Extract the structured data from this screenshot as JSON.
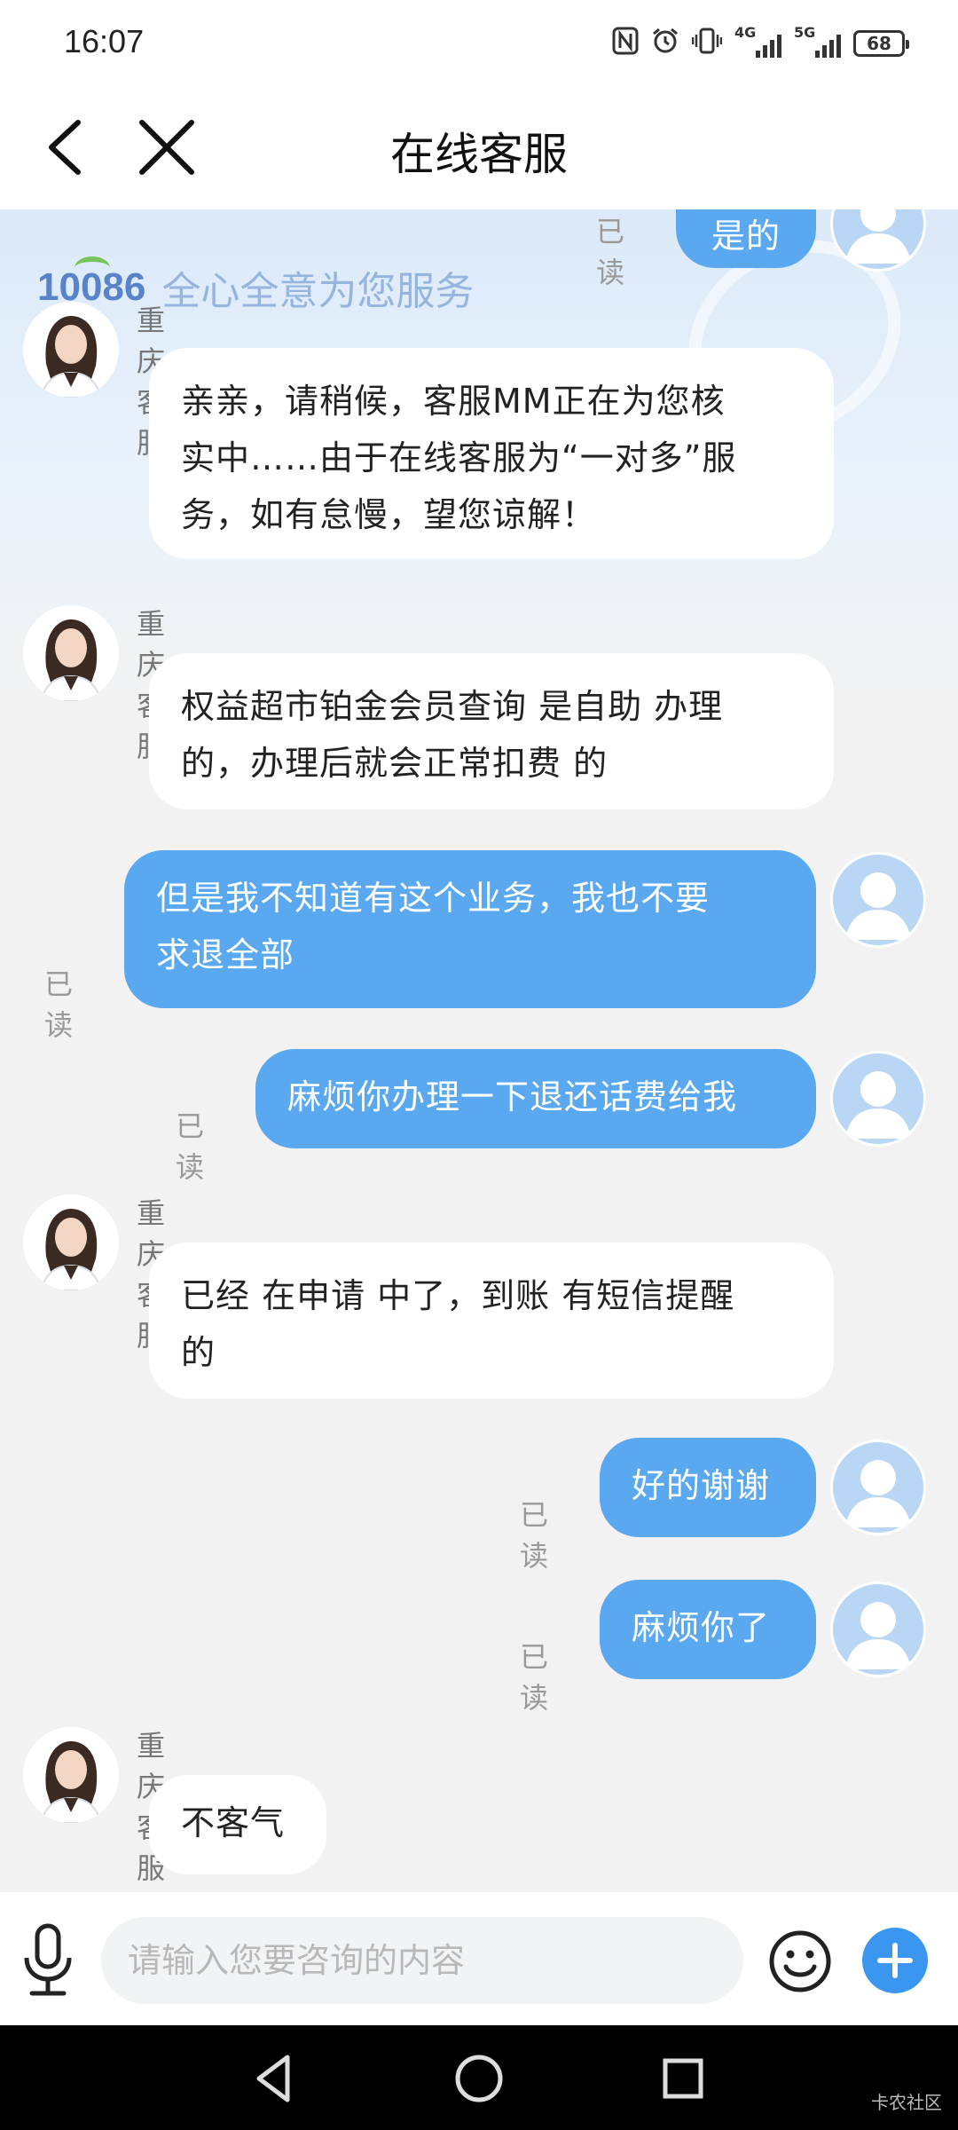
{
  "status_bar": {
    "time": "16:07",
    "icons": [
      "nfc-icon",
      "alarm-icon",
      "vibrate-icon",
      "signal-4g-icon",
      "signal-5g-icon",
      "battery-icon"
    ],
    "signal_1_label": "4G",
    "signal_2_label": "5G",
    "battery": "68"
  },
  "header": {
    "title": "在线客服"
  },
  "banner": {
    "logo": "10086",
    "slogan": "全心全意为您服务"
  },
  "messages": [
    {
      "from": "user",
      "text": "是的",
      "read": "已读"
    },
    {
      "from": "agent",
      "sender": "重庆客服",
      "lines": [
        "亲亲，请稍候，客服MM正在为您核",
        "实中……由于在线客服为“一对多”服",
        "务，如有怠慢，望您谅解！"
      ]
    },
    {
      "from": "agent",
      "sender": "重庆客服",
      "lines": [
        "权益超市铂金会员查询 是自助 办理",
        "的，办理后就会正常扣费 的"
      ]
    },
    {
      "from": "user",
      "lines": [
        "但是我不知道有这个业务，我也不要",
        "求退全部"
      ],
      "read": "已读"
    },
    {
      "from": "user",
      "lines": [
        "麻烦你办理一下退还话费给我"
      ],
      "read": "已读"
    },
    {
      "from": "agent",
      "sender": "重庆客服",
      "lines": [
        "已经 在申请 中了，到账 有短信提醒",
        "的"
      ]
    },
    {
      "from": "user",
      "lines": [
        "好的谢谢"
      ],
      "read": "已读"
    },
    {
      "from": "user",
      "lines": [
        "麻烦你了"
      ],
      "read": "已读"
    },
    {
      "from": "agent",
      "sender": "重庆客服",
      "lines": [
        "不客气"
      ]
    }
  ],
  "input_bar": {
    "placeholder": "请输入您要咨询的内容"
  },
  "watermark": "卡农社区",
  "colors": {
    "bubble_out": "#5aa8f0",
    "bubble_in": "#ffffff",
    "accent": "#3a96ef",
    "background": "#f2f2f2"
  }
}
